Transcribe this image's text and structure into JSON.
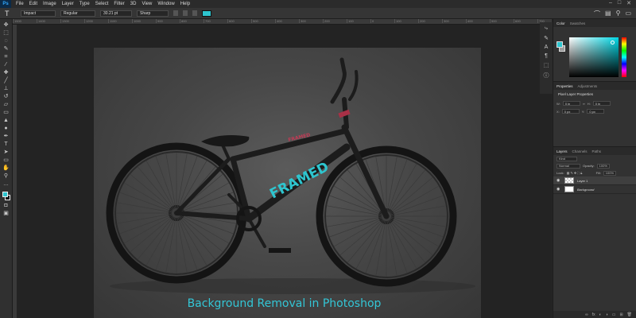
{
  "menubar": {
    "logo": "Ps",
    "items": [
      "File",
      "Edit",
      "Image",
      "Layer",
      "Type",
      "Select",
      "Filter",
      "3D",
      "View",
      "Window",
      "Help"
    ]
  },
  "options": {
    "tool_glyph": "T",
    "font_family": "Impact",
    "font_style": "Regular",
    "font_size": "30.21 pt",
    "antialias": "Sharp",
    "text_color": "#2ec5cf"
  },
  "ruler": {
    "ticks": [
      "1500",
      "1400",
      "1300",
      "1200",
      "1100",
      "1000",
      "900",
      "800",
      "700",
      "600",
      "500",
      "400",
      "300",
      "200",
      "100",
      "0",
      "100",
      "200",
      "300",
      "400",
      "500",
      "600",
      "700",
      "800",
      "900",
      "1000",
      "1100",
      "1200"
    ]
  },
  "panels": {
    "color_tabs": [
      "Color",
      "Swatches"
    ],
    "properties_tabs": [
      "Properties",
      "Adjustments"
    ],
    "properties_title": "Pixel Layer Properties",
    "prop_w": "0 in",
    "prop_h": "0 in",
    "prop_x": "0 px",
    "prop_y": "0 px",
    "layers_tabs": [
      "Layers",
      "Channels",
      "Paths"
    ],
    "kind_label": "Kind",
    "blend_mode": "Normal",
    "opacity_label": "Opacity:",
    "opacity_value": "100%",
    "lock_label": "Lock:",
    "fill_label": "Fill:",
    "fill_value": "100%",
    "layers": [
      {
        "name": "Layer 1",
        "selected": true
      },
      {
        "name": "Background",
        "selected": false
      }
    ]
  },
  "colors": {
    "accent": "#33c6d6",
    "foreground": "#2ec5cf",
    "background_chip": "#111111"
  },
  "caption": "Background Removal in Photoshop",
  "bike_text": "FRAMED"
}
